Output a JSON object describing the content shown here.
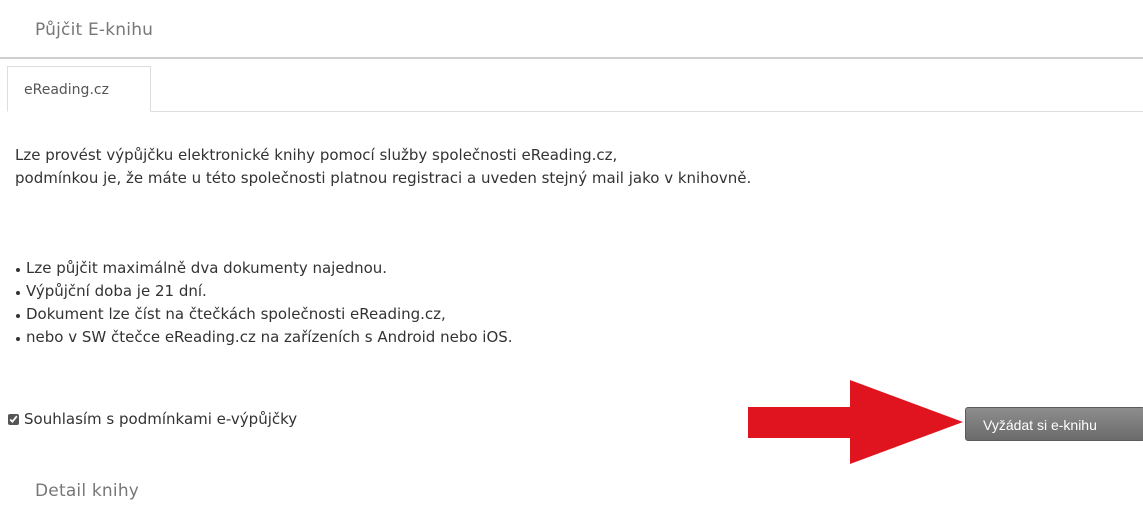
{
  "borrow_section": {
    "title": "Půjčit E-knihu",
    "tab_label": "eReading.cz",
    "intro_line_1": "Lze provést výpůjčku elektronické knihy pomocí služby společnosti eReading.cz,",
    "intro_line_2": "podmínkou je, že máte u této společnosti platnou registraci a uveden stejný mail jako v knihovně.",
    "rules": [
      "Lze půjčit maximálně dva dokumenty najednou.",
      "Výpůjční doba je 21 dní.",
      "Dokument lze číst na čtečkách společnosti eReading.cz,",
      "nebo v SW čtečce eReading.cz na zařízeních s Android nebo iOS."
    ],
    "agree_label": "Souhlasím s podmínkami e-výpůjčky",
    "agree_checked": true,
    "request_button_label": "Vyžádat si e-knihu"
  },
  "detail_section": {
    "title": "Detail knihy"
  },
  "colors": {
    "arrow": "#e0141e",
    "button": "#777777"
  }
}
